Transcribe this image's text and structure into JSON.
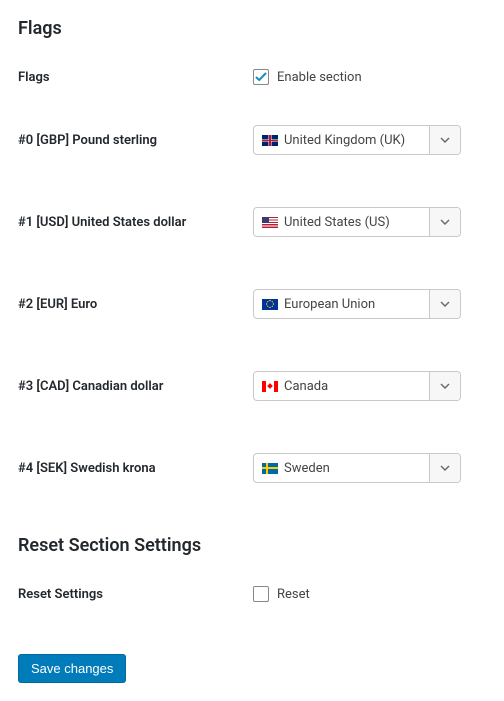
{
  "sections": {
    "flags": {
      "heading": "Flags",
      "enable": {
        "row_label": "Flags",
        "checkbox_label": "Enable section",
        "checked": true
      },
      "rows": [
        {
          "label": "#0 [GBP] Pound sterling",
          "selected": "United Kingdom (UK)",
          "flag": "uk"
        },
        {
          "label": "#1 [USD] United States dollar",
          "selected": "United States (US)",
          "flag": "us"
        },
        {
          "label": "#2 [EUR] Euro",
          "selected": "European Union",
          "flag": "eu"
        },
        {
          "label": "#3 [CAD] Canadian dollar",
          "selected": "Canada",
          "flag": "ca"
        },
        {
          "label": "#4 [SEK] Swedish krona",
          "selected": "Sweden",
          "flag": "se"
        }
      ]
    },
    "reset": {
      "heading": "Reset Section Settings",
      "row_label": "Reset Settings",
      "checkbox_label": "Reset",
      "checked": false
    }
  },
  "actions": {
    "save_label": "Save changes"
  },
  "colors": {
    "primary": "#007cba",
    "checkbox_check": "#1e8cbe"
  }
}
